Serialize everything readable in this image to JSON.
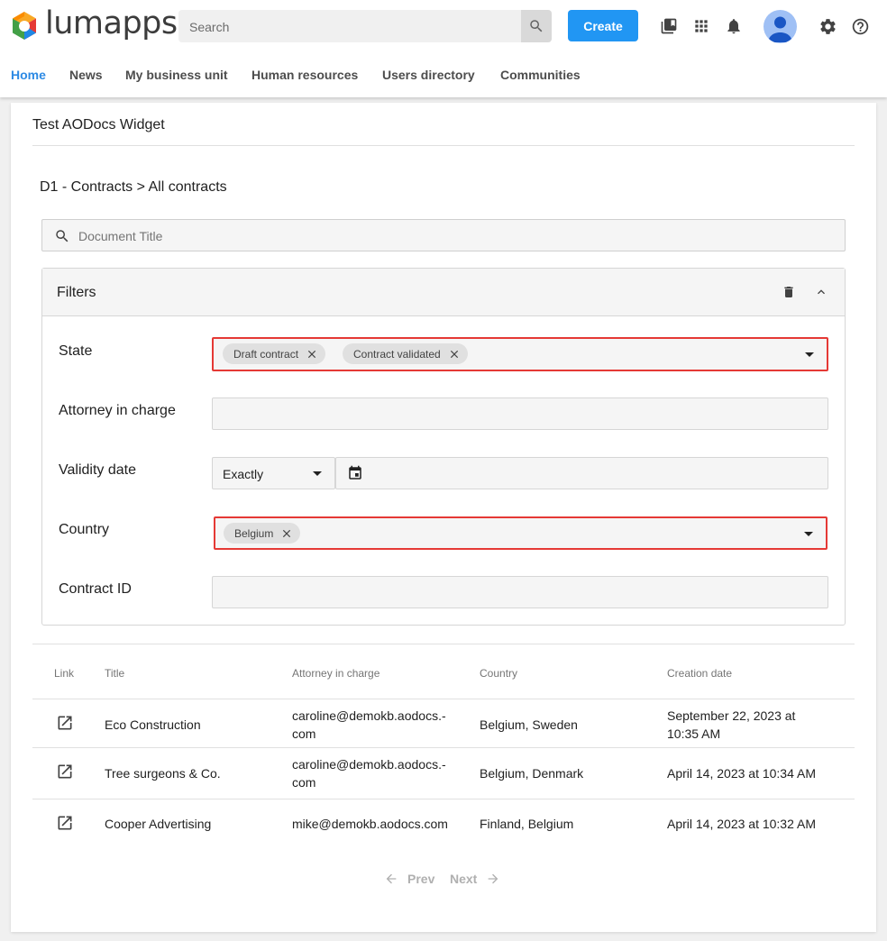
{
  "header": {
    "brand": "lumapps",
    "search_placeholder": "Search",
    "create_label": "Create",
    "nav": [
      "Home",
      "News",
      "My business unit",
      "Human resources",
      "Users directory",
      "Communities"
    ],
    "active_nav": "Home",
    "accent_color": "#2196f3"
  },
  "widget": {
    "title": "Test AODocs Widget",
    "breadcrumb": "D1 - Contracts > All contracts",
    "search_placeholder": "Document Title"
  },
  "filters": {
    "title": "Filters",
    "state": {
      "label": "State",
      "chips": [
        "Draft contract",
        "Contract validated"
      ]
    },
    "attorney": {
      "label": "Attorney in charge",
      "value": ""
    },
    "validity": {
      "label": "Validity date",
      "operator": "Exactly",
      "value": ""
    },
    "country": {
      "label": "Country",
      "chips": [
        "Belgium"
      ]
    },
    "contract_id": {
      "label": "Contract ID",
      "value": ""
    }
  },
  "table": {
    "columns": [
      "Link",
      "Title",
      "Attorney in charge",
      "Country",
      "Creation date"
    ],
    "rows": [
      {
        "title": "Eco Construction",
        "attorney_l1": "caroline@demokb.aodocs.-",
        "attorney_l2": "com",
        "country": "Belgium, Sweden",
        "date_l1": "September 22, 2023 at",
        "date_l2": "10:35 AM"
      },
      {
        "title": "Tree surgeons & Co.",
        "attorney_l1": "caroline@demokb.aodocs.-",
        "attorney_l2": "com",
        "country": "Belgium, Denmark",
        "date_l1": "April 14, 2023 at 10:34 AM",
        "date_l2": ""
      },
      {
        "title": "Cooper Advertising",
        "attorney_l1": "mike@demokb.aodocs.com",
        "attorney_l2": "",
        "country": "Finland, Belgium",
        "date_l1": "April 14, 2023 at 10:32 AM",
        "date_l2": ""
      }
    ]
  },
  "pager": {
    "prev": "Prev",
    "next": "Next"
  }
}
